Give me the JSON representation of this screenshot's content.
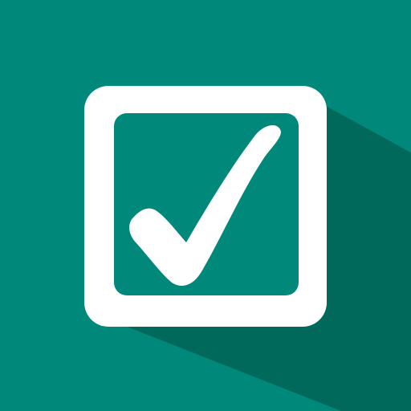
{
  "icon": {
    "name": "checkbox-checked-icon",
    "kind": "app-launcher-icon",
    "colors": {
      "background": "#00897b",
      "long_shadow": "#00695c",
      "box": "#ffffff",
      "box_inner": "#00897b",
      "checkmark": "#ffffff"
    }
  }
}
